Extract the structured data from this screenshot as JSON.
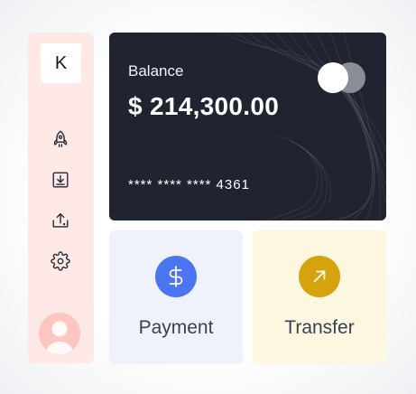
{
  "sidebar": {
    "logo": "K",
    "nav": [
      {
        "icon": "rocket-icon"
      },
      {
        "icon": "download-icon"
      },
      {
        "icon": "upload-icon"
      },
      {
        "icon": "gear-icon"
      }
    ],
    "avatar_icon": "user-avatar"
  },
  "card": {
    "balance_label": "Balance",
    "balance_amount": "$ 214,300.00",
    "masked_number": "**** **** **** 4361",
    "brand_icon": "card-brand-circles"
  },
  "actions": {
    "payment": {
      "label": "Payment",
      "icon": "dollar-icon",
      "accent": "#4c75f2"
    },
    "transfer": {
      "label": "Transfer",
      "icon": "arrow-up-right-icon",
      "accent": "#d4a30e"
    }
  },
  "colors": {
    "sidebar_bg": "#ffe9e7",
    "card_bg": "#1f2430",
    "payment_bg": "#eff2fb",
    "transfer_bg": "#fdf7e2"
  }
}
